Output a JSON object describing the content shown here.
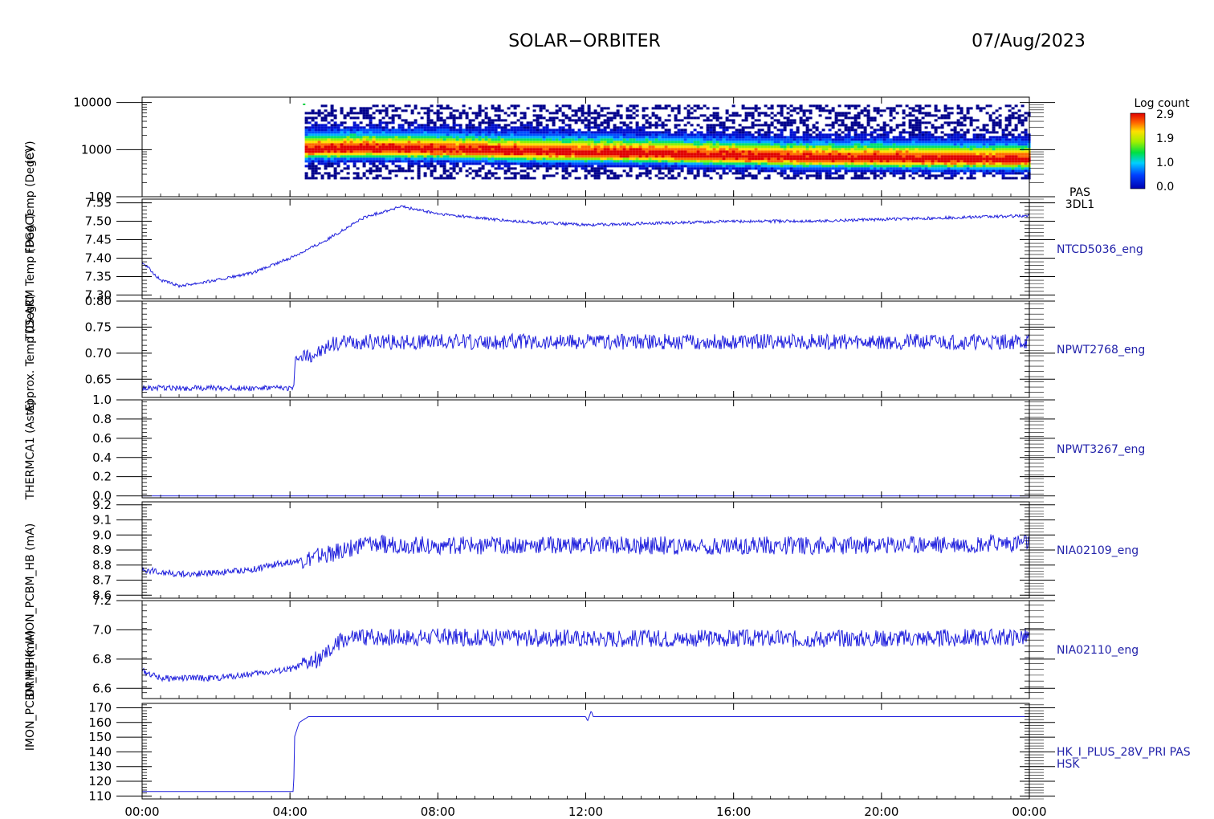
{
  "header": {
    "mission": "SOLAR−ORBITER",
    "date": "07/Aug/2023"
  },
  "colorbar": {
    "title": "Log count",
    "ticks": [
      "2.9",
      "1.9",
      "1.0",
      "0.0"
    ]
  },
  "x_axis": {
    "ticks": [
      "00:00",
      "04:00",
      "08:00",
      "12:00",
      "16:00",
      "20:00",
      "00:00"
    ]
  },
  "left_axis_titles": [
    "(eV)",
    "FPGA Temp (DegC)",
    "TDS ARM Temp (DegC)",
    "Approx. Temp (DegC)",
    "THERMCA1 (AstE)",
    "DRM_HK_IMON_PCBM_HB (mA)",
    "IMON_PCBM_HB (mA)"
  ],
  "colors": {
    "axis": "#000000",
    "trace": "#1f1fdc",
    "label": "#2222aa"
  },
  "chart_data": [
    {
      "type": "heatmap",
      "name": "PAS 3DL1",
      "label_lines": [
        "PAS",
        "3DL1"
      ],
      "y_scale": "log",
      "ylim": [
        100,
        13000
      ],
      "yticks": [
        100,
        1000,
        10000
      ],
      "ytick_labels": [
        "100",
        "1000",
        "10000"
      ],
      "data_start_hour": 4.4,
      "data_end_hour": 24,
      "energy_range": [
        250,
        9000
      ],
      "peak_energy_eV": [
        [
          4.4,
          1050
        ],
        [
          6,
          1100
        ],
        [
          8,
          1050
        ],
        [
          10,
          950
        ],
        [
          12,
          900
        ],
        [
          14,
          850
        ],
        [
          15,
          800
        ],
        [
          16,
          760
        ],
        [
          18,
          700
        ],
        [
          20,
          680
        ],
        [
          22,
          650
        ],
        [
          24,
          640
        ]
      ],
      "colorbar_range": [
        0.0,
        2.9
      ]
    },
    {
      "type": "line",
      "name": "NTCD5036_eng",
      "label_lines": [
        "NTCD5036_eng"
      ],
      "ylim": [
        7.29,
        7.56
      ],
      "yticks": [
        7.3,
        7.35,
        7.4,
        7.45,
        7.5,
        7.55
      ],
      "ytick_labels": [
        "7.30",
        "7.35",
        "7.40",
        "7.45",
        "7.50",
        "7.55"
      ],
      "noise": 0.004,
      "x": [
        0,
        0.5,
        1,
        2,
        3,
        4,
        5,
        6,
        7,
        8,
        9,
        10,
        12,
        14,
        16,
        18,
        20,
        22,
        24
      ],
      "y": [
        7.39,
        7.34,
        7.325,
        7.34,
        7.36,
        7.4,
        7.45,
        7.51,
        7.54,
        7.52,
        7.51,
        7.5,
        7.49,
        7.495,
        7.5,
        7.5,
        7.505,
        7.51,
        7.515
      ]
    },
    {
      "type": "line",
      "name": "NPWT2768_eng",
      "label_lines": [
        "NPWT2768_eng"
      ],
      "ylim": [
        0.615,
        0.8
      ],
      "yticks": [
        0.65,
        0.7,
        0.75,
        0.8
      ],
      "ytick_labels": [
        "0.65",
        "0.70",
        "0.75",
        "0.80"
      ],
      "noise": 0.015,
      "x": [
        0,
        4.1,
        4.15,
        4.8,
        5.2,
        6,
        12,
        18,
        24
      ],
      "y": [
        0.633,
        0.633,
        0.69,
        0.7,
        0.72,
        0.722,
        0.722,
        0.722,
        0.722
      ]
    },
    {
      "type": "line",
      "name": "NPWT3267_eng",
      "label_lines": [
        "NPWT3267_eng"
      ],
      "ylim": [
        -0.02,
        1.0
      ],
      "yticks": [
        0.0,
        0.2,
        0.4,
        0.6,
        0.8,
        1.0
      ],
      "ytick_labels": [
        "0.0",
        "0.2",
        "0.4",
        "0.6",
        "0.8",
        "1.0"
      ],
      "noise": 0,
      "x": [
        0,
        24
      ],
      "y": [
        0.0,
        0.0
      ]
    },
    {
      "type": "line",
      "name": "NIA02109_eng",
      "label_lines": [
        "NIA02109_eng"
      ],
      "ylim": [
        8.58,
        9.22
      ],
      "yticks": [
        8.6,
        8.7,
        8.8,
        8.9,
        9.0,
        9.1,
        9.2
      ],
      "ytick_labels": [
        "8.6",
        "8.7",
        "8.8",
        "8.9",
        "9.0",
        "9.1",
        "9.2"
      ],
      "noise": 0.06,
      "x": [
        0,
        1,
        2,
        3,
        3.5,
        4.5,
        5.2,
        6,
        8,
        12,
        16,
        20,
        24
      ],
      "y": [
        8.77,
        8.74,
        8.75,
        8.77,
        8.8,
        8.84,
        8.88,
        8.94,
        8.93,
        8.93,
        8.93,
        8.93,
        8.95
      ]
    },
    {
      "type": "line",
      "name": "NIA02110_eng",
      "label_lines": [
        "NIA02110_eng"
      ],
      "ylim": [
        6.53,
        7.2
      ],
      "yticks": [
        6.6,
        6.8,
        7.0,
        7.2
      ],
      "ytick_labels": [
        "6.6",
        "6.8",
        "7.0",
        "7.2"
      ],
      "noise": 0.06,
      "x": [
        0,
        0.2,
        0.5,
        1,
        2,
        3,
        4,
        4.5,
        5,
        5.4,
        6,
        8,
        12,
        16,
        20,
        24
      ],
      "y": [
        6.72,
        6.7,
        6.67,
        6.67,
        6.67,
        6.7,
        6.73,
        6.77,
        6.83,
        6.93,
        6.95,
        6.95,
        6.94,
        6.94,
        6.94,
        6.95
      ]
    },
    {
      "type": "line",
      "name": "HK_I_PLUS_28V_PRI PAS HSK",
      "label_lines": [
        "HK_I_PLUS_28V_PRI PAS",
        "HSK"
      ],
      "ylim": [
        108,
        173
      ],
      "yticks": [
        110,
        120,
        130,
        140,
        150,
        160,
        170
      ],
      "ytick_labels": [
        "110",
        "120",
        "130",
        "140",
        "150",
        "160",
        "170"
      ],
      "noise": 0,
      "x": [
        0,
        4.1,
        4.12,
        4.25,
        4.5,
        12,
        12.05,
        12.15,
        12.2,
        24
      ],
      "y": [
        113,
        113,
        150,
        160,
        164,
        164,
        161,
        168,
        164,
        164
      ]
    }
  ]
}
